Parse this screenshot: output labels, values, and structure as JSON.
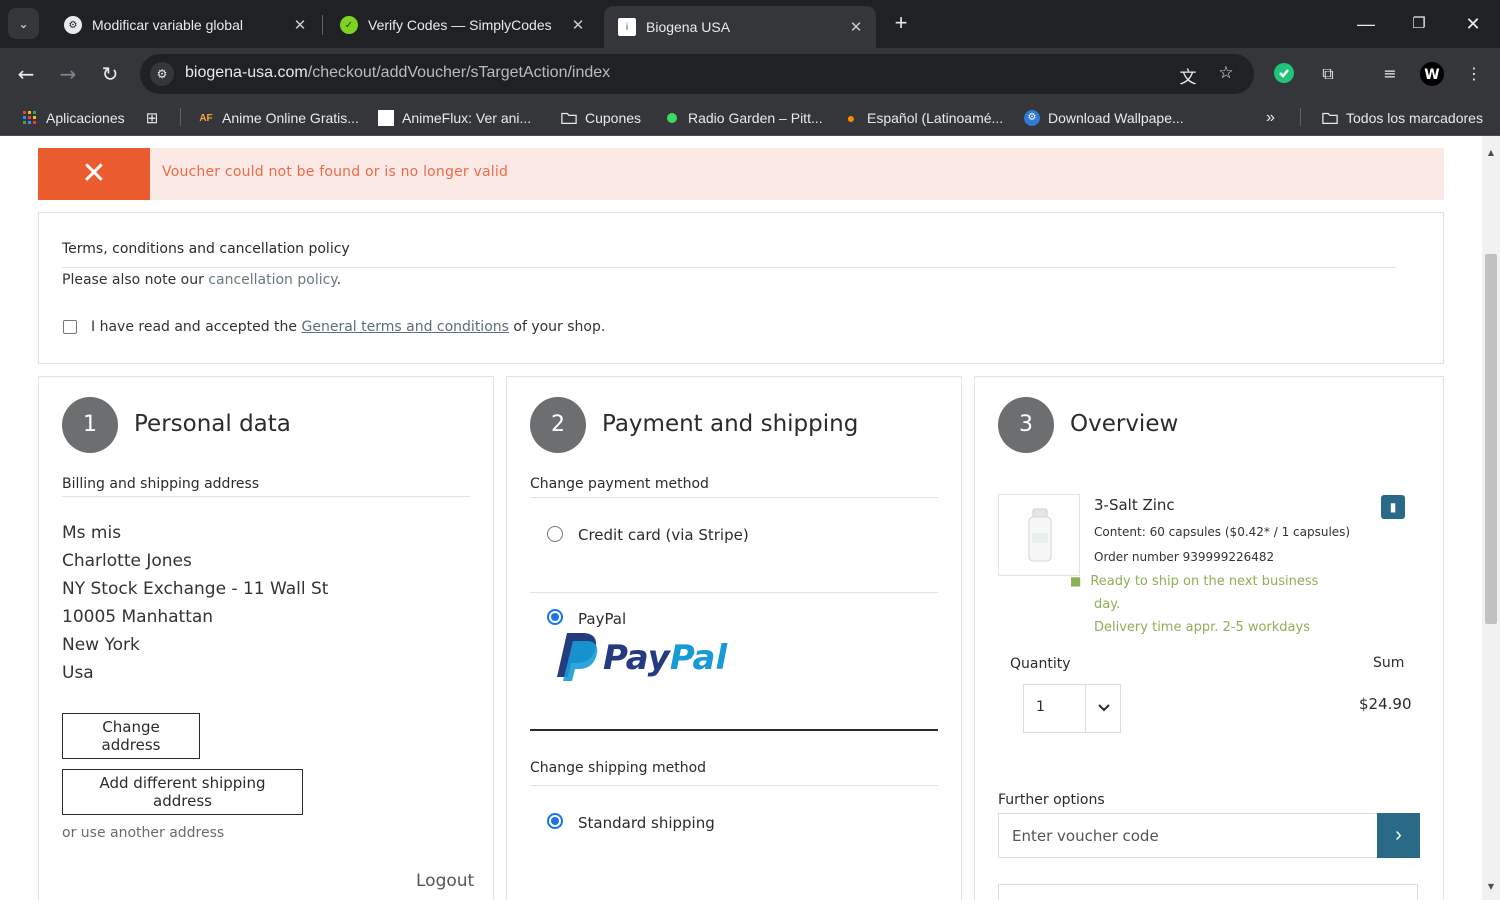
{
  "browser": {
    "tabs": [
      {
        "title": "Modificar variable global",
        "icon": "settings-gear-icon"
      },
      {
        "title": "Verify Codes — SimplyCodes",
        "icon": "simplycodes-icon"
      },
      {
        "title": "Biogena USA",
        "icon": "biogena-icon"
      }
    ],
    "url_host": "biogena-usa.com",
    "url_path": "/checkout/addVoucher/sTargetAction/index",
    "bookmarks": [
      {
        "label": "Aplicaciones",
        "icon": "apps-grid-icon"
      },
      {
        "label": "Anime Online Gratis...",
        "icon": "af-icon"
      },
      {
        "label": "AnimeFlux: Ver ani...",
        "icon": "white-square-icon"
      },
      {
        "label": "Cupones",
        "icon": "folder-icon"
      },
      {
        "label": "Radio Garden – Pitt...",
        "icon": "green-dot-icon"
      },
      {
        "label": "Español (Latinoamé...",
        "icon": "fox-icon"
      },
      {
        "label": "Download Wallpape...",
        "icon": "gear-badge-icon"
      }
    ],
    "all_bookmarks": "Todos los marcadores"
  },
  "alert": {
    "message": "Voucher could not be found or is no longer valid"
  },
  "terms": {
    "title": "Terms, conditions and cancellation policy",
    "note_prefix": "Please also note our ",
    "note_link": "cancellation policy",
    "note_suffix": ".",
    "accept_prefix": "I have read and accepted the ",
    "accept_link": "General terms and conditions",
    "accept_suffix": " of your shop."
  },
  "personal": {
    "step": "1",
    "title": "Personal data",
    "section": "Billing and shipping address",
    "address": [
      "Ms mis",
      "Charlotte Jones",
      "NY Stock Exchange - 11 Wall St",
      "10005 Manhattan",
      "New York",
      "Usa"
    ],
    "change_address": "Change address",
    "add_shipping": "Add different shipping address",
    "other_address": "or use another address",
    "logout": "Logout"
  },
  "payment": {
    "step": "2",
    "title": "Payment and shipping",
    "payment_section": "Change payment method",
    "methods": [
      {
        "label": "Credit card (via Stripe)",
        "selected": false
      },
      {
        "label": "PayPal",
        "selected": true
      }
    ],
    "paypal_logo_text": "PayPal",
    "shipping_section": "Change shipping method",
    "shipping_methods": [
      {
        "label": "Standard shipping",
        "selected": true
      }
    ],
    "colors": {
      "radio": "#1a73e8",
      "paypal_dark": "#253b80",
      "paypal_light": "#179bd7"
    }
  },
  "overview": {
    "step": "3",
    "title": "Overview",
    "product": {
      "name": "3-Salt Zinc",
      "content": "Content: 60 capsules ($0.42* / 1 capsules)",
      "order_number": "Order number 939999226482",
      "ready_line1": "Ready to ship on the next business",
      "ready_line2": "day.",
      "delivery": "Delivery time appr. 2-5 workdays"
    },
    "quantity_label": "Quantity",
    "quantity_value": "1",
    "sum_label": "Sum",
    "sum_value": "$24.90",
    "further_options": "Further options",
    "voucher_placeholder": "Enter voucher code",
    "colors": {
      "accent": "#296b86",
      "ready": "#8ab157",
      "alert": "#ea5b2e"
    }
  }
}
